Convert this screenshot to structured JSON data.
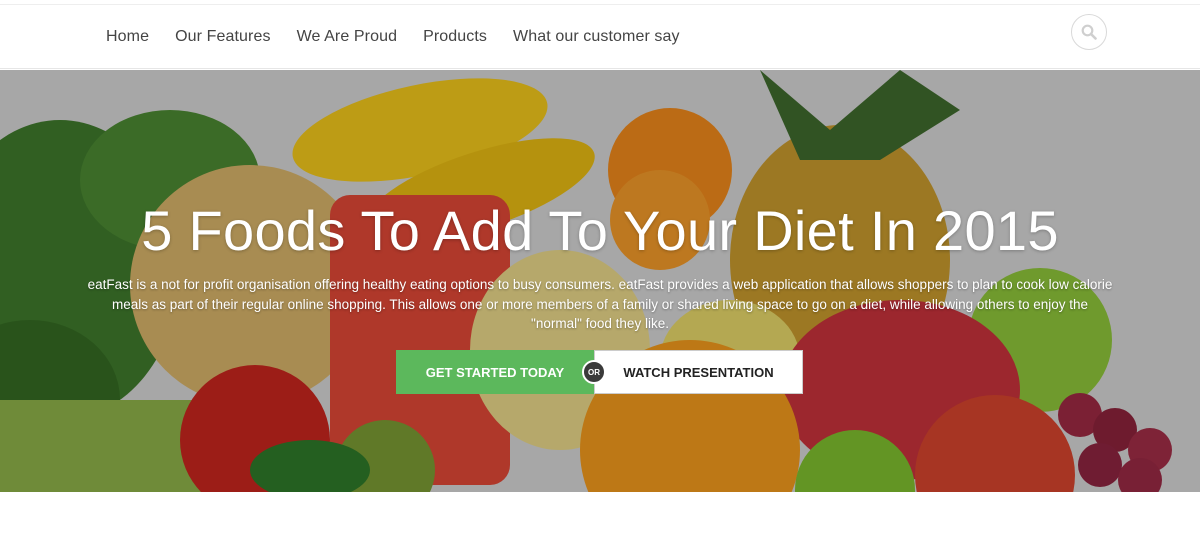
{
  "nav": {
    "items": [
      {
        "label": "Home"
      },
      {
        "label": "Our Features"
      },
      {
        "label": "We Are Proud"
      },
      {
        "label": "Products"
      },
      {
        "label": "What our customer say"
      }
    ],
    "search_icon": "search-icon"
  },
  "hero": {
    "title": "5 Foods To Add To Your Diet In 2015",
    "description": "eatFast is a not for profit organisation offering healthy eating options to busy consumers. eatFast provides a web application that allows shoppers to plan to cook low calorie meals as part of their regular online shopping. This allows one or more members of a family or shared living space to go on a diet, while allowing others to enjoy the \"normal\" food they like.",
    "primary_button": "GET STARTED TODAY",
    "or_label": "OR",
    "secondary_button": "WATCH PRESENTATION",
    "colors": {
      "primary": "#5cb85c",
      "or_badge": "#3a3a3a"
    }
  }
}
